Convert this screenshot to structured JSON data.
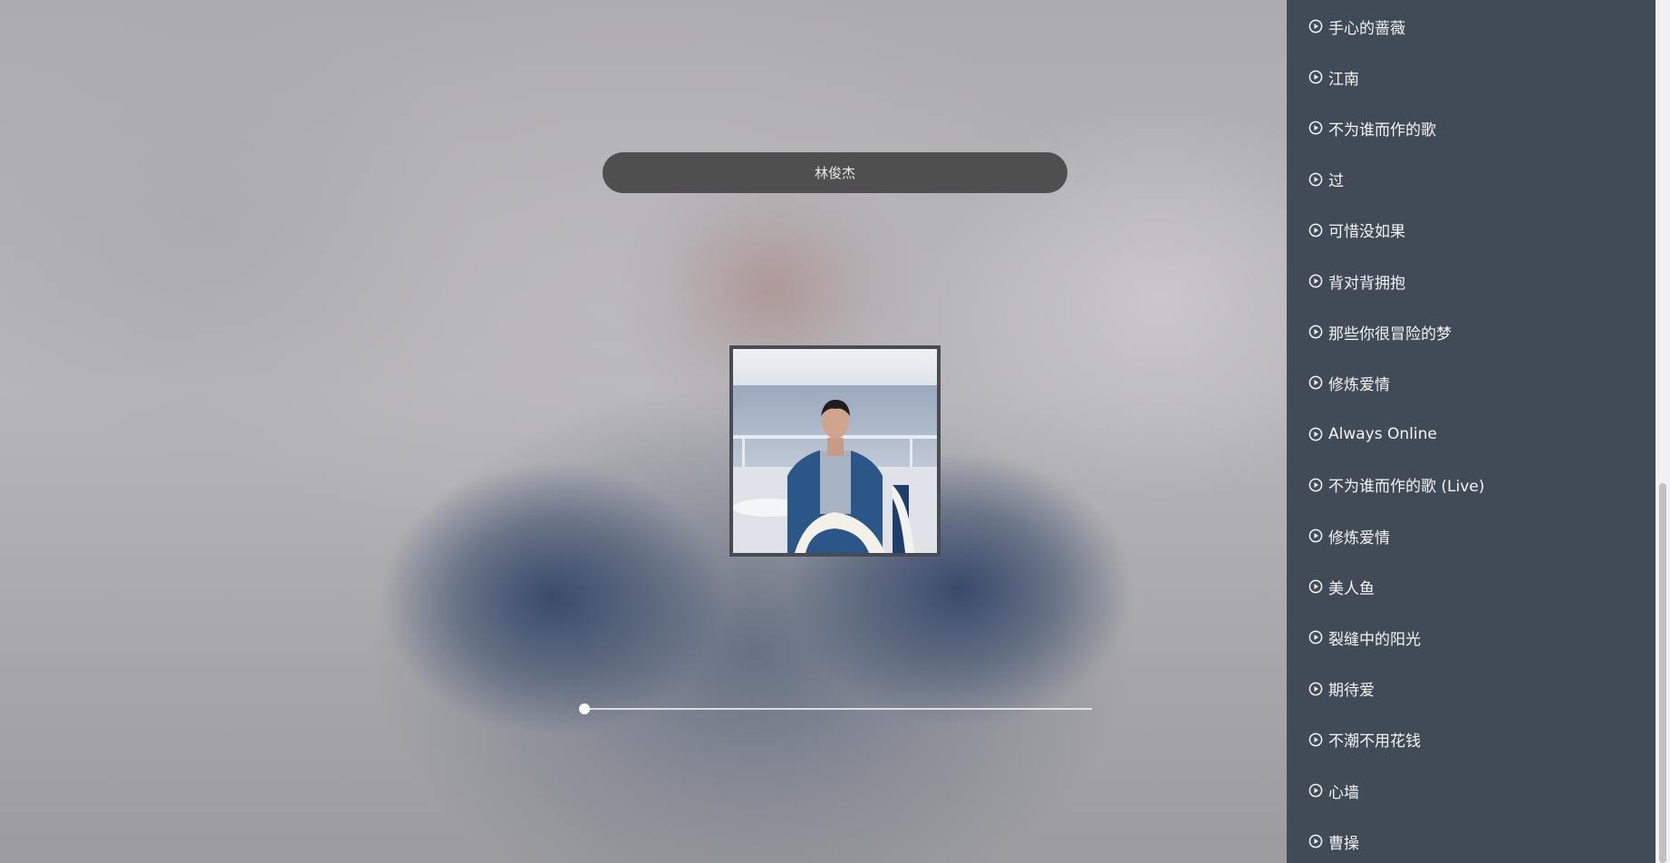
{
  "player": {
    "artist": "林俊杰",
    "progress_fraction": 0.0
  },
  "playlist": {
    "tracks": [
      "手心的蔷薇",
      "江南",
      "不为谁而作的歌",
      "过",
      "可惜没如果",
      "背对背拥抱",
      "那些你很冒险的梦",
      "修炼爱情",
      "Always Online",
      "不为谁而作的歌 (Live)",
      "修炼爱情",
      "美人鱼",
      "裂缝中的阳光",
      "期待爱",
      "不潮不用花钱",
      "心墙",
      "曹操"
    ]
  },
  "scroll": {
    "scrolled_fraction": 0.56,
    "visible_fraction": 0.44
  }
}
